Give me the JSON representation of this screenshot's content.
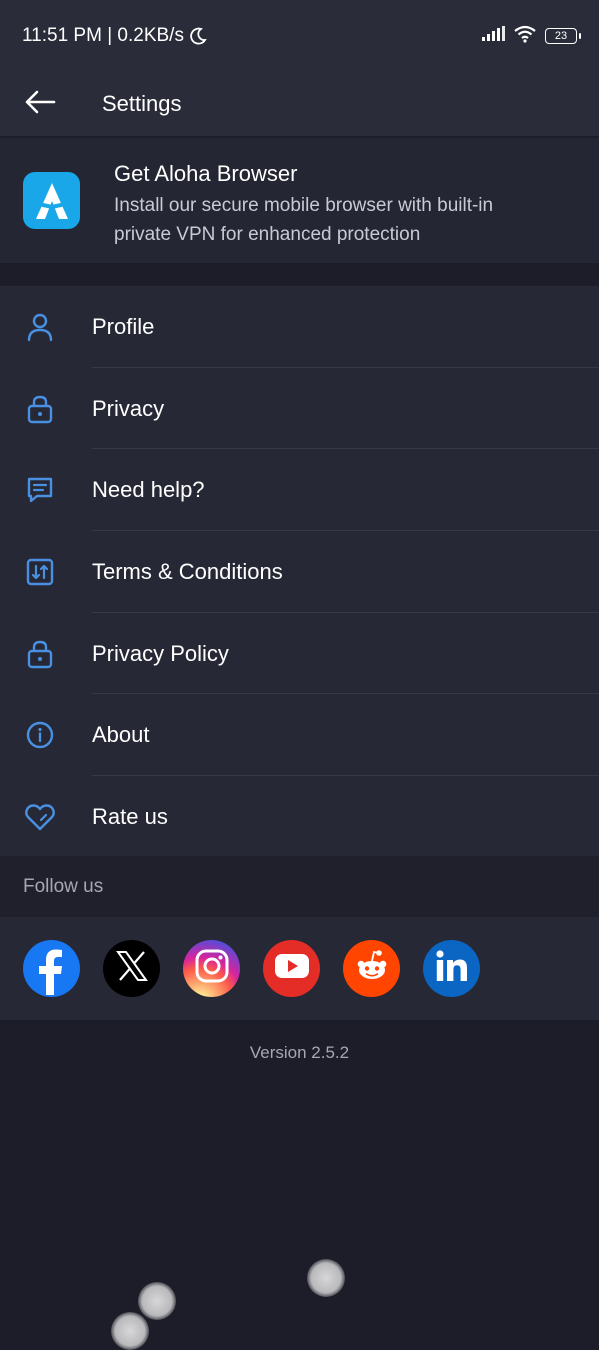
{
  "status_bar": {
    "time_speed": "11:51 PM | 0.2KB/s",
    "battery": "23"
  },
  "app_bar": {
    "title": "Settings",
    "back_icon": "arrow-left-icon"
  },
  "promo": {
    "title": "Get Aloha Browser",
    "description_line1": "Install our secure mobile browser with built-in",
    "description_line2": "private VPN for enhanced protection",
    "logo_color": "#1aa7ea"
  },
  "menu": {
    "accent_color": "#4a90e2",
    "items": [
      {
        "label": "Profile",
        "icon": "person-icon"
      },
      {
        "label": "Privacy",
        "icon": "lock-icon"
      },
      {
        "label": "Need help?",
        "icon": "chat-icon"
      },
      {
        "label": "Terms & Conditions",
        "icon": "swap-doc-icon"
      },
      {
        "label": "Privacy Policy",
        "icon": "lock-icon"
      },
      {
        "label": "About",
        "icon": "info-icon"
      },
      {
        "label": "Rate us",
        "icon": "heart-icon"
      }
    ]
  },
  "follow": {
    "title": "Follow us",
    "networks": [
      {
        "name": "facebook",
        "color": "#1877f2"
      },
      {
        "name": "x",
        "color": "#000000"
      },
      {
        "name": "instagram",
        "color": "#e1306c"
      },
      {
        "name": "youtube",
        "color": "#e52d27"
      },
      {
        "name": "reddit",
        "color": "#ff4500"
      },
      {
        "name": "linkedin",
        "color": "#0a66c2"
      }
    ]
  },
  "version": "Version 2.5.2"
}
